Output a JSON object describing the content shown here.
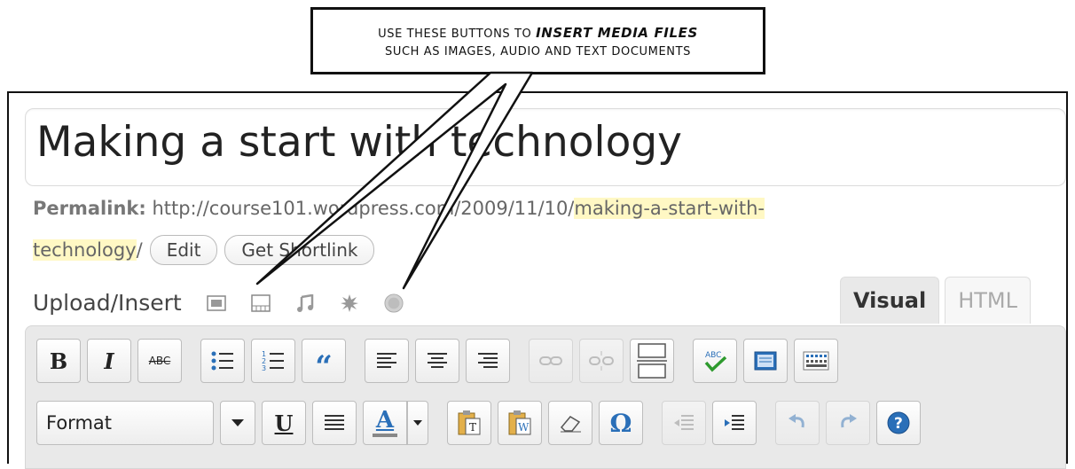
{
  "callout": {
    "line1_prefix": "Use these buttons to ",
    "line1_emphasis": "insert media files",
    "line2": "such as images, audio and text documents"
  },
  "post": {
    "title": "Making a start with technology"
  },
  "permalink": {
    "label": "Permalink:",
    "base_url": "http://course101.wordpress.com/2009/11/10/",
    "slug_part1": "making-a-start-with-",
    "slug_part2": "technology",
    "trailing": "/",
    "edit_label": "Edit",
    "shortlink_label": "Get Shortlink"
  },
  "upload": {
    "label": "Upload/Insert",
    "icons": [
      "image-icon",
      "video-icon",
      "audio-icon",
      "media-icon",
      "other-media-icon"
    ]
  },
  "tabs": {
    "visual": "Visual",
    "html": "HTML"
  },
  "toolbar": {
    "row1": [
      "bold",
      "italic",
      "strikethrough",
      "unordered-list",
      "ordered-list",
      "blockquote",
      "align-left",
      "align-center",
      "align-right",
      "link",
      "unlink",
      "more",
      "spellcheck",
      "fullscreen",
      "kitchen-sink"
    ],
    "row2": [
      "format",
      "underline",
      "justify",
      "text-color",
      "paste-text",
      "paste-word",
      "remove-format",
      "special-char",
      "outdent",
      "indent",
      "undo",
      "redo",
      "help"
    ],
    "format_label": "Format",
    "bold_label": "B",
    "italic_label": "I",
    "strike_label": "ABC",
    "quote_label": "“",
    "underline_label": "U",
    "color_label": "A",
    "omega_label": "Ω"
  }
}
